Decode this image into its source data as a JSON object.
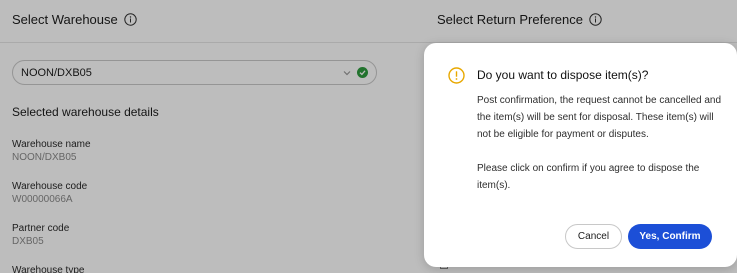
{
  "left_section": {
    "title": "Select Warehouse",
    "select_value": "NOON/DXB05",
    "details_heading": "Selected warehouse details",
    "details": [
      {
        "label": "Warehouse name",
        "value": "NOON/DXB05"
      },
      {
        "label": "Warehouse code",
        "value": "W00000066A"
      },
      {
        "label": "Partner code",
        "value": "DXB05"
      },
      {
        "label": "Warehouse type",
        "value": ""
      }
    ]
  },
  "right_section": {
    "title": "Select Return Preference"
  },
  "modal": {
    "title": "Do you want to dispose item(s)?",
    "paragraph_1": "Post confirmation, the request cannot be cancelled and the item(s) will be sent for disposal. These item(s) will not be eligible for payment or disputes.",
    "paragraph_2": "Please click on confirm if you agree to dispose the item(s).",
    "cancel_label": "Cancel",
    "confirm_label": "Yes, Confirm"
  },
  "icons": {
    "info": "info-circle-icon",
    "warning": "warning-circle-icon",
    "chevron": "chevron-down-icon",
    "check": "check-circle-icon"
  },
  "colors": {
    "primary": "#1c4fd7",
    "warning": "#e8a800",
    "success": "#2e9b3e",
    "overlay": "rgba(0,0,0,0.26)"
  }
}
